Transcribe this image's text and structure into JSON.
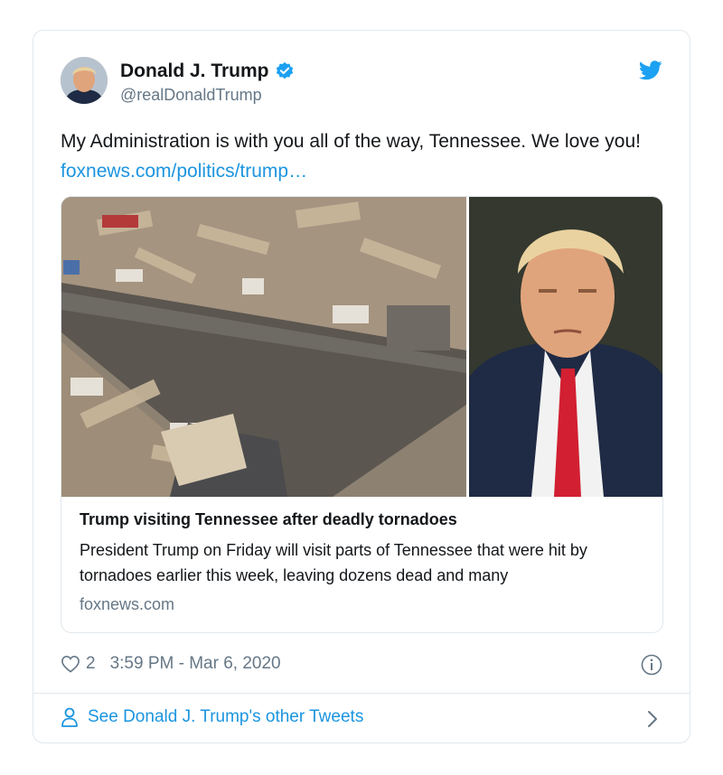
{
  "tweet": {
    "author_name": "Donald J. Trump",
    "author_handle": "@realDonaldTrump",
    "text": "My Administration is with you all of the way, Tennessee. We love you! ",
    "link_text": "foxnews.com/politics/trump…",
    "likes": "2",
    "timestamp": "3:59 PM - Mar 6, 2020"
  },
  "link_card": {
    "title": "Trump visiting Tennessee after deadly tornadoes",
    "description": "President Trump on Friday will visit parts of Tennessee that were hit by tornadoes earlier this week, leaving dozens dead and many",
    "domain": "foxnews.com"
  },
  "footer": {
    "see_more": "See Donald J. Trump's other Tweets"
  },
  "icons": {
    "verified": "verified-badge-icon",
    "bird": "twitter-bird-icon",
    "heart": "heart-icon",
    "info": "info-icon",
    "person": "person-icon",
    "chevron": "chevron-right-icon"
  },
  "colors": {
    "accent": "#1b95e0",
    "muted": "#657786",
    "border": "#e1e8ed",
    "text": "#14171a"
  }
}
